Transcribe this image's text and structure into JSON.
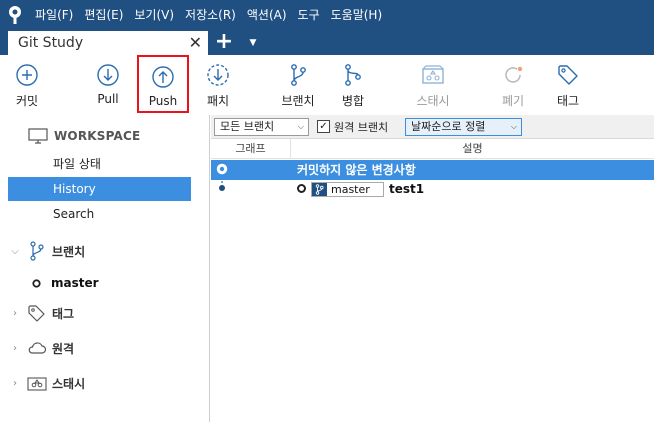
{
  "menubar": {
    "items": [
      "파일(F)",
      "편집(E)",
      "보기(V)",
      "저장소(R)",
      "액션(A)",
      "도구",
      "도움말(H)"
    ]
  },
  "tabs": {
    "active": "Git Study",
    "close_glyph": "✕",
    "add_glyph": "+",
    "menu_glyph": "▼"
  },
  "toolbar": {
    "items": [
      {
        "label": "커밋",
        "icon": "plus-circle-icon",
        "state": "enabled"
      },
      {
        "label": "Pull",
        "icon": "arrow-down-circle-icon",
        "state": "enabled"
      },
      {
        "label": "Push",
        "icon": "arrow-up-circle-icon",
        "state": "highlighted"
      },
      {
        "label": "패치",
        "icon": "dashed-download-icon",
        "state": "enabled"
      },
      {
        "label": "브랜치",
        "icon": "branch-icon",
        "state": "enabled"
      },
      {
        "label": "병합",
        "icon": "merge-icon",
        "state": "enabled"
      },
      {
        "label": "스태시",
        "icon": "stash-icon",
        "state": "disabled"
      },
      {
        "label": "폐기",
        "icon": "discard-icon",
        "state": "disabled"
      },
      {
        "label": "태그",
        "icon": "tag-icon",
        "state": "enabled"
      }
    ],
    "highlight_color": "#e8141c"
  },
  "sidebar": {
    "workspace_label": "WORKSPACE",
    "workspace_items": [
      {
        "label": "파일 상태",
        "active": false
      },
      {
        "label": "History",
        "active": true
      },
      {
        "label": "Search",
        "active": false
      }
    ],
    "sections": [
      {
        "label": "브랜치",
        "icon": "branch-icon",
        "expanded": true
      },
      {
        "label": "태그",
        "icon": "tag-icon",
        "expanded": false
      },
      {
        "label": "원격",
        "icon": "cloud-icon",
        "expanded": false
      },
      {
        "label": "스태시",
        "icon": "stash-icon",
        "expanded": false
      }
    ],
    "branches": [
      "master"
    ],
    "active_color": "#3c8fe0"
  },
  "filterbar": {
    "branch_filter": "모든 브랜치",
    "remote_checkbox_label": "원격 브랜치",
    "remote_checked": true,
    "sort": "날짜순으로 정렬"
  },
  "history": {
    "columns": [
      "그래프",
      "설명"
    ],
    "rows": [
      {
        "description": "커밋하지 않은 변경사항",
        "selected": true
      },
      {
        "description": "test1",
        "branch_tag": "master",
        "selected": false
      }
    ]
  },
  "colors": {
    "brand": "#205081",
    "accent": "#3c8fe0"
  }
}
